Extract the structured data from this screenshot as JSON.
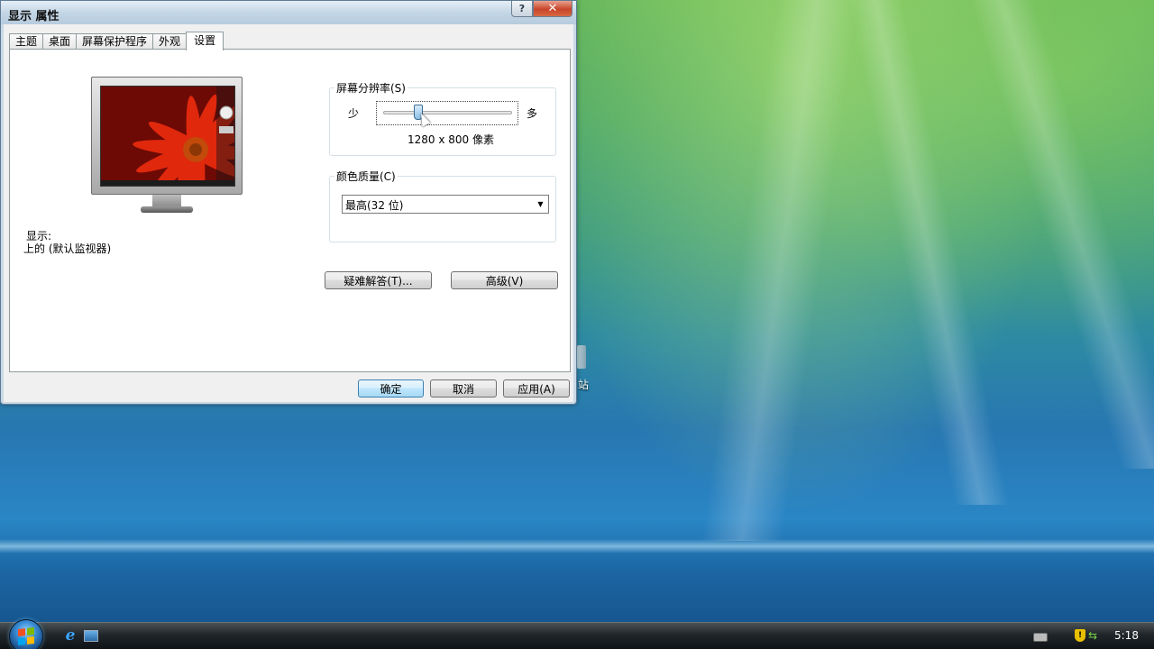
{
  "window": {
    "title": "显示 属性",
    "help_label": "?",
    "close_label": "✕"
  },
  "tabs": [
    {
      "label": "主题"
    },
    {
      "label": "桌面"
    },
    {
      "label": "屏幕保护程序"
    },
    {
      "label": "外观"
    },
    {
      "label": "设置",
      "active": true
    }
  ],
  "settings": {
    "display_label": "显示:",
    "display_value": "上的 (默认监视器)",
    "resolution": {
      "title": "屏幕分辨率(S)",
      "less": "少",
      "more": "多",
      "value": "1280 x 800 像素"
    },
    "color_quality": {
      "title": "颜色质量(C)",
      "selected": "最高(32 位)"
    },
    "troubleshoot_button": "疑难解答(T)...",
    "advanced_button": "高级(V)"
  },
  "dialog_buttons": {
    "ok": "确定",
    "cancel": "取消",
    "apply": "应用(A)"
  },
  "desktop": {
    "recycle_bin_label_fragment": "站"
  },
  "taskbar": {
    "clock": "5:18"
  }
}
